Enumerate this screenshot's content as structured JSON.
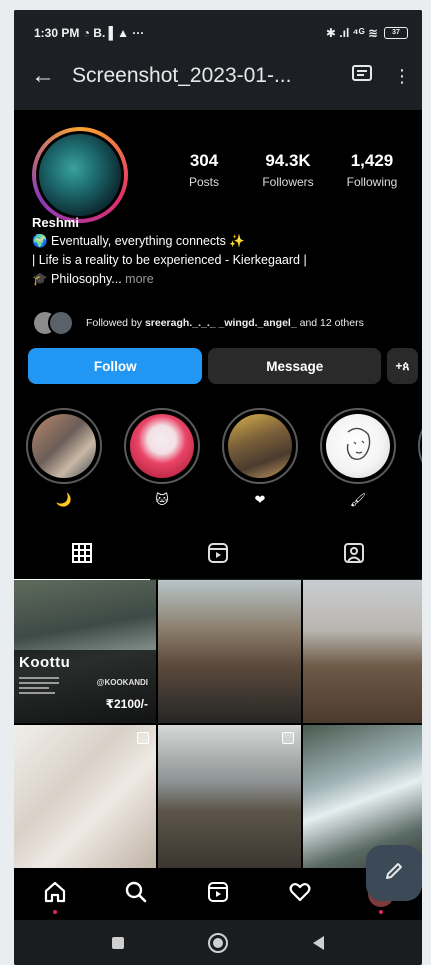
{
  "status_bar": {
    "time": "1:30 PM",
    "left_icons": "◔ B. ▌▲ ···",
    "right_icons": "✱ .ıl ⁴ᴳ ≋",
    "battery": "37"
  },
  "viewer": {
    "title": "Screenshot_2023-01-...",
    "back_icon": "arrow-left-icon",
    "caption_icon": "message-icon",
    "more_icon": "more-vertical-icon"
  },
  "profile": {
    "posts_count": "304",
    "posts_label": "Posts",
    "followers_count": "94.3K",
    "followers_label": "Followers",
    "following_count": "1,429",
    "following_label": "Following",
    "name": "Reshmi",
    "bio_line1": "🌍 Eventually, everything connects ✨",
    "bio_line2": "| Life is a reality to be experienced - Kierkegaard |",
    "bio_line3": "🎓 Philosophy...",
    "more_label": " more",
    "followed_by_prefix": "Followed by ",
    "followed_by_names": "sreeragh._._._ _wingd._angel_",
    "followed_by_suffix": " and 12 others"
  },
  "buttons": {
    "follow": "Follow",
    "message": "Message",
    "add_person": "+ጰ"
  },
  "stories": [
    {
      "label": "🌙"
    },
    {
      "label": "🐱"
    },
    {
      "label": "❤"
    },
    {
      "label": "🖌"
    },
    {
      "label": ""
    }
  ],
  "tabs": [
    {
      "name": "grid-icon"
    },
    {
      "name": "reels-icon"
    },
    {
      "name": "tagged-icon"
    }
  ],
  "post_overlay": {
    "title": "Koottu",
    "tag": "@KOOKANDI",
    "price": "₹2100/-"
  },
  "colors": {
    "follow_blue": "#2196f3",
    "notify_dot": "#e0245e",
    "fab": "#3b4a56"
  }
}
